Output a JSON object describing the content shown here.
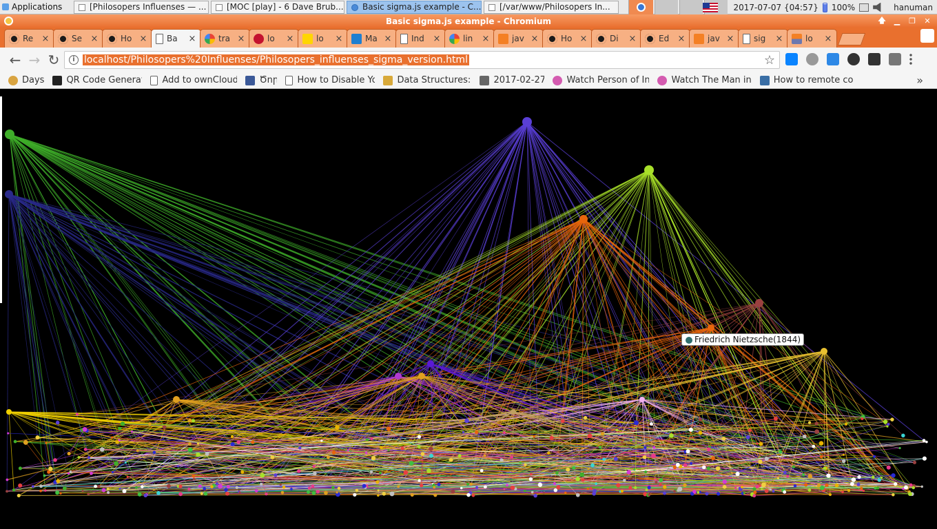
{
  "os_panel": {
    "apps_label": "Applications",
    "tasks": [
      {
        "label": "[Philosopers Influenses — ..."
      },
      {
        "label": "[MOC [play] - 6 Dave Brub..."
      },
      {
        "label": "Basic sigma.js example - C..."
      },
      {
        "label": "[/var/www/Philosopers In..."
      }
    ],
    "clock": "2017-07-07 {04:57}",
    "battery": "100%",
    "user": "hanuman"
  },
  "window": {
    "title": "Basic sigma.js example - Chromium"
  },
  "tabs": [
    {
      "label": "Re",
      "icon": "github"
    },
    {
      "label": "Se",
      "icon": "github"
    },
    {
      "label": "Ho",
      "icon": "github"
    },
    {
      "label": "Ba",
      "icon": "doc"
    },
    {
      "label": "tra",
      "icon": "google"
    },
    {
      "label": "lo",
      "icon": "redflower"
    },
    {
      "label": "lo",
      "icon": "wd"
    },
    {
      "label": "Ma",
      "icon": "mail"
    },
    {
      "label": "Ind",
      "icon": "doc"
    },
    {
      "label": "lin",
      "icon": "google"
    },
    {
      "label": "jav",
      "icon": "so"
    },
    {
      "label": "Ho",
      "icon": "github"
    },
    {
      "label": "Di",
      "icon": "github"
    },
    {
      "label": "Ed",
      "icon": "github"
    },
    {
      "label": "jav",
      "icon": "so"
    },
    {
      "label": "sig",
      "icon": "doc"
    },
    {
      "label": "lo",
      "icon": "pma"
    }
  ],
  "omnibox": {
    "url": "localhost/Philosopers%20Influenses/Philosopers_influenses_sigma_version.html"
  },
  "bookmarks": [
    {
      "label": "Days",
      "icon": "days"
    },
    {
      "label": "QR Code Generato",
      "icon": "qr"
    },
    {
      "label": "Add to ownCloud",
      "icon": "page"
    },
    {
      "label": "Ծոր",
      "icon": "fb"
    },
    {
      "label": "How to Disable Yo",
      "icon": "page"
    },
    {
      "label": "Data Structures: C",
      "icon": "ejs"
    },
    {
      "label": "2017-02-27",
      "icon": "folder"
    },
    {
      "label": "Watch Person of In",
      "icon": "play"
    },
    {
      "label": "Watch The Man in",
      "icon": "play"
    },
    {
      "label": "How to remote co",
      "icon": "tr"
    }
  ],
  "graph": {
    "hovered_node_label": "Friedrich Nietzsche(1844)",
    "hovered_node_color": "#2f6e6e"
  }
}
